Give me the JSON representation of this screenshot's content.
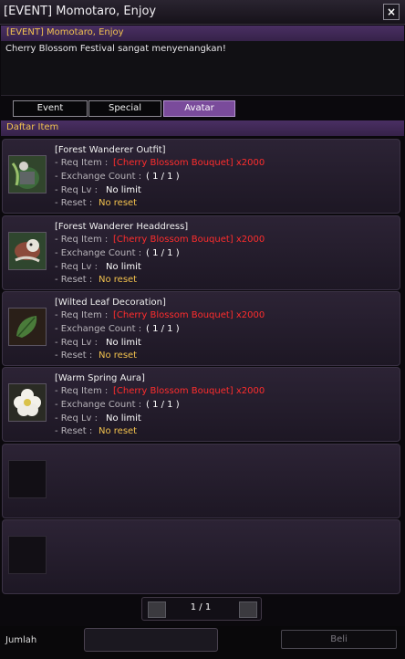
{
  "window": {
    "title": "[EVENT] Momotaro, Enjoy"
  },
  "npc": {
    "name": "[EVENT] Momotaro, Enjoy",
    "dialog": "Cherry Blossom Festival sangat menyenangkan!"
  },
  "tabs": [
    {
      "label": "Event",
      "active": false
    },
    {
      "label": "Special",
      "active": false
    },
    {
      "label": "Avatar",
      "active": true
    }
  ],
  "list": {
    "header": "Daftar Item",
    "labels": {
      "req_item": "- Req Item :",
      "exchange_count": "- Exchange Count :",
      "req_lv": "- Req Lv :",
      "reset": "- Reset :"
    },
    "items": [
      {
        "name": "[Forest Wanderer Outfit]",
        "req_item": "[Cherry Blossom Bouquet] x2000",
        "exchange_count": "( 1 / 1 )",
        "req_lv": "No limit",
        "reset": "No reset",
        "icon": "outfit-icon"
      },
      {
        "name": "[Forest Wanderer Headdress]",
        "req_item": "[Cherry Blossom Bouquet] x2000",
        "exchange_count": "( 1 / 1 )",
        "req_lv": "No limit",
        "reset": "No reset",
        "icon": "headdress-icon"
      },
      {
        "name": "[Wilted Leaf Decoration]",
        "req_item": "[Cherry Blossom Bouquet] x2000",
        "exchange_count": "( 1 / 1 )",
        "req_lv": "No limit",
        "reset": "No reset",
        "icon": "leaf-icon"
      },
      {
        "name": "[Warm Spring Aura]",
        "req_item": "[Cherry Blossom Bouquet] x2000",
        "exchange_count": "( 1 / 1 )",
        "req_lv": "No limit",
        "reset": "No reset",
        "icon": "flower-icon"
      }
    ]
  },
  "pagination": {
    "text": "1 / 1"
  },
  "bottom": {
    "quantity_label": "Jumlah",
    "quantity_value": "",
    "buy_label": "Beli"
  },
  "colors": {
    "accent": "#7a4b9b",
    "header_text": "#f1c24f",
    "req_item": "#ff2d2d"
  }
}
